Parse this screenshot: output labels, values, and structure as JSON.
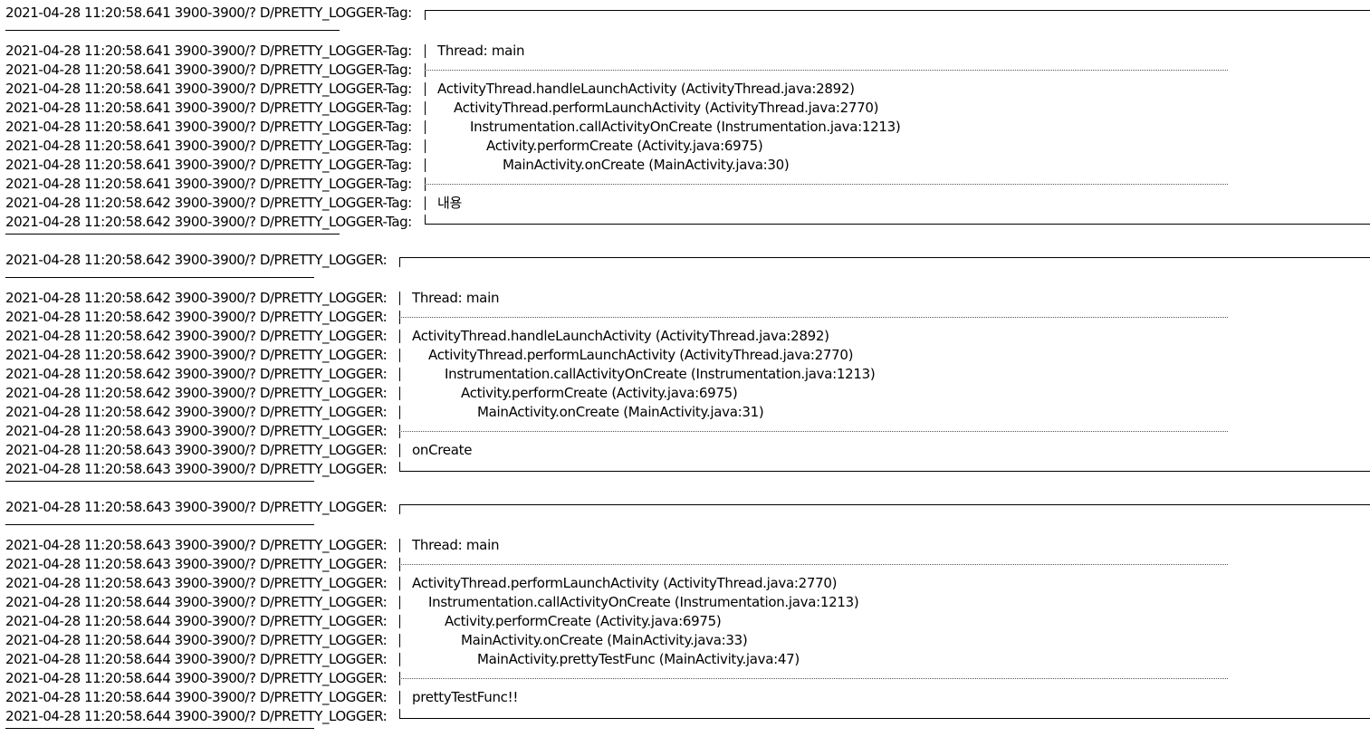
{
  "log_lines": [
    {
      "prefix": "2021-04-28 11:20:58.641 3900-3900/? D/PRETTY_LOGGER-Tag:",
      "kind": "top",
      "text": ""
    },
    {
      "prefix": "2021-04-28 11:20:58.641 3900-3900/? D/PRETTY_LOGGER-Tag:",
      "kind": "msg",
      "indent": 0,
      "text": "Thread: main"
    },
    {
      "prefix": "2021-04-28 11:20:58.641 3900-3900/? D/PRETTY_LOGGER-Tag:",
      "kind": "sep",
      "text": ""
    },
    {
      "prefix": "2021-04-28 11:20:58.641 3900-3900/? D/PRETTY_LOGGER-Tag:",
      "kind": "msg",
      "indent": 0,
      "text": "ActivityThread.handleLaunchActivity  (ActivityThread.java:2892)"
    },
    {
      "prefix": "2021-04-28 11:20:58.641 3900-3900/? D/PRETTY_LOGGER-Tag:",
      "kind": "msg",
      "indent": 1,
      "text": "ActivityThread.performLaunchActivity  (ActivityThread.java:2770)"
    },
    {
      "prefix": "2021-04-28 11:20:58.641 3900-3900/? D/PRETTY_LOGGER-Tag:",
      "kind": "msg",
      "indent": 2,
      "text": "Instrumentation.callActivityOnCreate  (Instrumentation.java:1213)"
    },
    {
      "prefix": "2021-04-28 11:20:58.641 3900-3900/? D/PRETTY_LOGGER-Tag:",
      "kind": "msg",
      "indent": 3,
      "text": "Activity.performCreate  (Activity.java:6975)"
    },
    {
      "prefix": "2021-04-28 11:20:58.641 3900-3900/? D/PRETTY_LOGGER-Tag:",
      "kind": "msg",
      "indent": 4,
      "text": "MainActivity.onCreate  (MainActivity.java:30)"
    },
    {
      "prefix": "2021-04-28 11:20:58.641 3900-3900/? D/PRETTY_LOGGER-Tag:",
      "kind": "sep",
      "text": ""
    },
    {
      "prefix": "2021-04-28 11:20:58.642 3900-3900/? D/PRETTY_LOGGER-Tag:",
      "kind": "msg",
      "indent": 0,
      "text": "내용"
    },
    {
      "prefix": "2021-04-28 11:20:58.642 3900-3900/? D/PRETTY_LOGGER-Tag:",
      "kind": "bottom",
      "text": ""
    },
    {
      "prefix": "2021-04-28 11:20:58.642 3900-3900/? D/PRETTY_LOGGER:",
      "kind": "top",
      "text": ""
    },
    {
      "prefix": "2021-04-28 11:20:58.642 3900-3900/? D/PRETTY_LOGGER:",
      "kind": "msg",
      "indent": 0,
      "text": "Thread: main"
    },
    {
      "prefix": "2021-04-28 11:20:58.642 3900-3900/? D/PRETTY_LOGGER:",
      "kind": "sep",
      "text": ""
    },
    {
      "prefix": "2021-04-28 11:20:58.642 3900-3900/? D/PRETTY_LOGGER:",
      "kind": "msg",
      "indent": 0,
      "text": "ActivityThread.handleLaunchActivity  (ActivityThread.java:2892)"
    },
    {
      "prefix": "2021-04-28 11:20:58.642 3900-3900/? D/PRETTY_LOGGER:",
      "kind": "msg",
      "indent": 1,
      "text": "ActivityThread.performLaunchActivity  (ActivityThread.java:2770)"
    },
    {
      "prefix": "2021-04-28 11:20:58.642 3900-3900/? D/PRETTY_LOGGER:",
      "kind": "msg",
      "indent": 2,
      "text": "Instrumentation.callActivityOnCreate  (Instrumentation.java:1213)"
    },
    {
      "prefix": "2021-04-28 11:20:58.642 3900-3900/? D/PRETTY_LOGGER:",
      "kind": "msg",
      "indent": 3,
      "text": "Activity.performCreate  (Activity.java:6975)"
    },
    {
      "prefix": "2021-04-28 11:20:58.642 3900-3900/? D/PRETTY_LOGGER:",
      "kind": "msg",
      "indent": 4,
      "text": "MainActivity.onCreate  (MainActivity.java:31)"
    },
    {
      "prefix": "2021-04-28 11:20:58.643 3900-3900/? D/PRETTY_LOGGER:",
      "kind": "sep",
      "text": ""
    },
    {
      "prefix": "2021-04-28 11:20:58.643 3900-3900/? D/PRETTY_LOGGER:",
      "kind": "msg",
      "indent": 0,
      "text": "onCreate"
    },
    {
      "prefix": "2021-04-28 11:20:58.643 3900-3900/? D/PRETTY_LOGGER:",
      "kind": "bottom",
      "text": ""
    },
    {
      "prefix": "2021-04-28 11:20:58.643 3900-3900/? D/PRETTY_LOGGER:",
      "kind": "top",
      "text": ""
    },
    {
      "prefix": "2021-04-28 11:20:58.643 3900-3900/? D/PRETTY_LOGGER:",
      "kind": "msg",
      "indent": 0,
      "text": "Thread: main"
    },
    {
      "prefix": "2021-04-28 11:20:58.643 3900-3900/? D/PRETTY_LOGGER:",
      "kind": "sep",
      "text": ""
    },
    {
      "prefix": "2021-04-28 11:20:58.643 3900-3900/? D/PRETTY_LOGGER:",
      "kind": "msg",
      "indent": 0,
      "text": "ActivityThread.performLaunchActivity  (ActivityThread.java:2770)"
    },
    {
      "prefix": "2021-04-28 11:20:58.644 3900-3900/? D/PRETTY_LOGGER:",
      "kind": "msg",
      "indent": 1,
      "text": "Instrumentation.callActivityOnCreate  (Instrumentation.java:1213)"
    },
    {
      "prefix": "2021-04-28 11:20:58.644 3900-3900/? D/PRETTY_LOGGER:",
      "kind": "msg",
      "indent": 2,
      "text": "Activity.performCreate  (Activity.java:6975)"
    },
    {
      "prefix": "2021-04-28 11:20:58.644 3900-3900/? D/PRETTY_LOGGER:",
      "kind": "msg",
      "indent": 3,
      "text": "MainActivity.onCreate  (MainActivity.java:33)"
    },
    {
      "prefix": "2021-04-28 11:20:58.644 3900-3900/? D/PRETTY_LOGGER:",
      "kind": "msg",
      "indent": 4,
      "text": "MainActivity.prettyTestFunc  (MainActivity.java:47)"
    },
    {
      "prefix": "2021-04-28 11:20:58.644 3900-3900/? D/PRETTY_LOGGER:",
      "kind": "sep",
      "text": ""
    },
    {
      "prefix": "2021-04-28 11:20:58.644 3900-3900/? D/PRETTY_LOGGER:",
      "kind": "msg",
      "indent": 0,
      "text": "prettyTestFunc!!"
    },
    {
      "prefix": "2021-04-28 11:20:58.644 3900-3900/? D/PRETTY_LOGGER:",
      "kind": "bottom",
      "text": ""
    }
  ]
}
